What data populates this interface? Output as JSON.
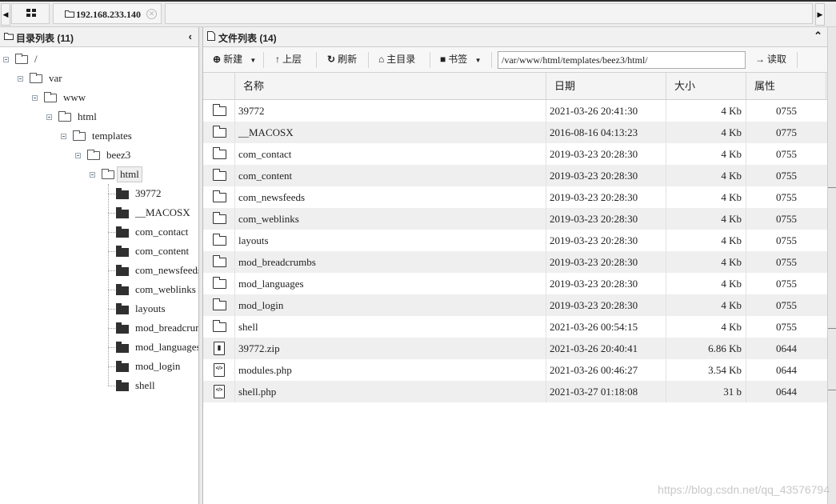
{
  "tabbar": {
    "host_tab_label": "192.168.233.140",
    "left_arrow": "◀",
    "right_arrow": "▶",
    "close_glyph": "✕"
  },
  "tree": {
    "title": "目录列表 (11)",
    "collapse_glyph": "‹",
    "path_nodes": [
      "/",
      "var",
      "www",
      "html",
      "templates",
      "beez3",
      "html"
    ],
    "children": [
      "39772",
      "__MACOSX",
      "com_contact",
      "com_content",
      "com_newsfeeds",
      "com_weblinks",
      "layouts",
      "mod_breadcrumbs",
      "mod_languages",
      "mod_login",
      "shell"
    ]
  },
  "filelist": {
    "title": "文件列表 (14)",
    "collapse_glyph": "⌃",
    "toolbar": {
      "new_label": "新建",
      "up_label": "上层",
      "refresh_label": "刷新",
      "home_label": "主目录",
      "bookmark_label": "书签",
      "read_label": "读取",
      "path_value": "/var/www/html/templates/beez3/html/"
    },
    "columns": {
      "name": "名称",
      "date": "日期",
      "size": "大小",
      "perm": "属性"
    },
    "rows": [
      {
        "type": "folder",
        "name": "39772",
        "date": "2021-03-26 20:41:30",
        "size": "4 Kb",
        "perm": "0755"
      },
      {
        "type": "folder",
        "name": "__MACOSX",
        "date": "2016-08-16 04:13:23",
        "size": "4 Kb",
        "perm": "0775"
      },
      {
        "type": "folder",
        "name": "com_contact",
        "date": "2019-03-23 20:28:30",
        "size": "4 Kb",
        "perm": "0755"
      },
      {
        "type": "folder",
        "name": "com_content",
        "date": "2019-03-23 20:28:30",
        "size": "4 Kb",
        "perm": "0755"
      },
      {
        "type": "folder",
        "name": "com_newsfeeds",
        "date": "2019-03-23 20:28:30",
        "size": "4 Kb",
        "perm": "0755"
      },
      {
        "type": "folder",
        "name": "com_weblinks",
        "date": "2019-03-23 20:28:30",
        "size": "4 Kb",
        "perm": "0755"
      },
      {
        "type": "folder",
        "name": "layouts",
        "date": "2019-03-23 20:28:30",
        "size": "4 Kb",
        "perm": "0755"
      },
      {
        "type": "folder",
        "name": "mod_breadcrumbs",
        "date": "2019-03-23 20:28:30",
        "size": "4 Kb",
        "perm": "0755"
      },
      {
        "type": "folder",
        "name": "mod_languages",
        "date": "2019-03-23 20:28:30",
        "size": "4 Kb",
        "perm": "0755"
      },
      {
        "type": "folder",
        "name": "mod_login",
        "date": "2019-03-23 20:28:30",
        "size": "4 Kb",
        "perm": "0755"
      },
      {
        "type": "folder",
        "name": "shell",
        "date": "2021-03-26 00:54:15",
        "size": "4 Kb",
        "perm": "0755"
      },
      {
        "type": "zip",
        "name": "39772.zip",
        "date": "2021-03-26 20:40:41",
        "size": "6.86 Kb",
        "perm": "0644"
      },
      {
        "type": "code",
        "name": "modules.php",
        "date": "2021-03-26 00:46:27",
        "size": "3.54 Kb",
        "perm": "0644"
      },
      {
        "type": "code",
        "name": "shell.php",
        "date": "2021-03-27 01:18:08",
        "size": "31 b",
        "perm": "0644"
      }
    ]
  },
  "watermark": "https://blog.csdn.net/qq_43576794"
}
